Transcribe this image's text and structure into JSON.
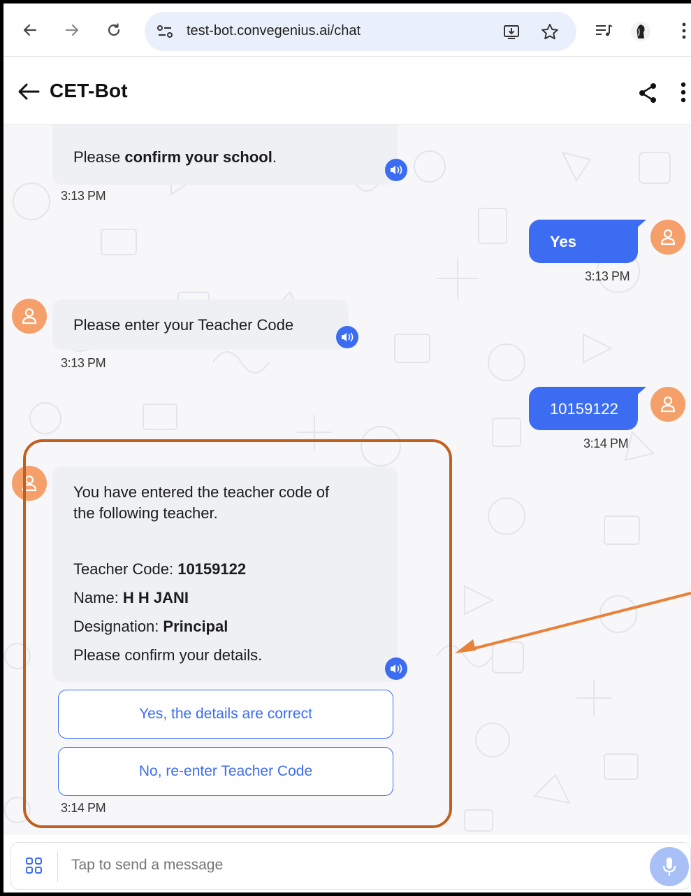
{
  "browser": {
    "url": "test-bot.convegenius.ai/chat"
  },
  "app": {
    "title": "CET-Bot"
  },
  "messages": {
    "m1": {
      "pre": "Please ",
      "bold": "confirm your school",
      "post": ".",
      "time": "3:13 PM"
    },
    "m2": {
      "text": "Yes",
      "time": "3:13 PM"
    },
    "m3": {
      "text": "Please enter your Teacher Code",
      "time": "3:13 PM"
    },
    "m4": {
      "text": "10159122",
      "time": "3:14 PM"
    },
    "m5": {
      "line1": "You have entered the teacher code of",
      "line2": "the following teacher.",
      "code_label": "Teacher Code: ",
      "code_value": "10159122",
      "name_label": "Name: ",
      "name_value": "H H JANI",
      "designation_label": "Designation: ",
      "designation_value": "Principal",
      "confirm": "Please confirm your details.",
      "time": "3:14 PM"
    }
  },
  "options": {
    "yes": "Yes, the details are correct",
    "no": "No, re-enter Teacher Code"
  },
  "composer": {
    "placeholder": "Tap to send a message"
  },
  "colors": {
    "accent": "#3b6cf2",
    "avatar": "#f5a06b",
    "highlight": "#c0601e",
    "arrow": "#e8813a"
  }
}
